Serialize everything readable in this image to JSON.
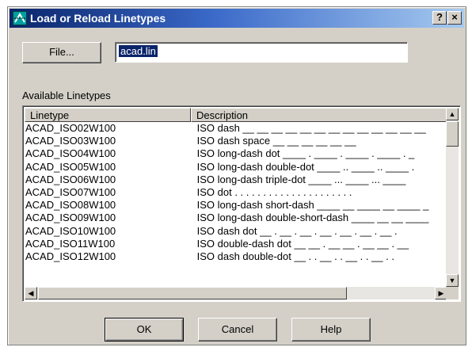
{
  "window": {
    "title": "Load or Reload Linetypes",
    "help_button": "?",
    "close_button": "×"
  },
  "file_button": {
    "label": "File..."
  },
  "file_field": {
    "value": "acad.lin"
  },
  "group_label": "Available Linetypes",
  "list": {
    "columns": [
      "Linetype",
      "Description"
    ],
    "rows": [
      {
        "linetype": "ACAD_ISO02W100",
        "description": "ISO dash __ __ __ __ __ __ __ __ __ __ __ __ __"
      },
      {
        "linetype": "ACAD_ISO03W100",
        "description": "ISO dash space __    __    __    __    __    __"
      },
      {
        "linetype": "ACAD_ISO04W100",
        "description": "ISO long-dash dot ____ . ____ . ____ . ____ . _"
      },
      {
        "linetype": "ACAD_ISO05W100",
        "description": "ISO long-dash double-dot ____ .. ____ .. ____ ."
      },
      {
        "linetype": "ACAD_ISO06W100",
        "description": "ISO long-dash triple-dot ____ ... ____ ... ____"
      },
      {
        "linetype": "ACAD_ISO07W100",
        "description": "ISO dot . . . . . . . . . . . . . . . . . . . . ."
      },
      {
        "linetype": "ACAD_ISO08W100",
        "description": "ISO long-dash short-dash ____ __ ____ __ ____ _"
      },
      {
        "linetype": "ACAD_ISO09W100",
        "description": "ISO long-dash double-short-dash ____ __ __ ____"
      },
      {
        "linetype": "ACAD_ISO10W100",
        "description": "ISO dash dot __ . __ . __ . __ . __ . __ . __ ."
      },
      {
        "linetype": "ACAD_ISO11W100",
        "description": "ISO double-dash dot __ __ . __ __ . __ __ . __"
      },
      {
        "linetype": "ACAD_ISO12W100",
        "description": "ISO dash double-dot __ . . __ . . __ . . __ . ."
      }
    ]
  },
  "scroll": {
    "up": "▲",
    "down": "▼",
    "left": "◀",
    "right": "▶"
  },
  "buttons": {
    "ok": "OK",
    "cancel": "Cancel",
    "help": "Help"
  }
}
